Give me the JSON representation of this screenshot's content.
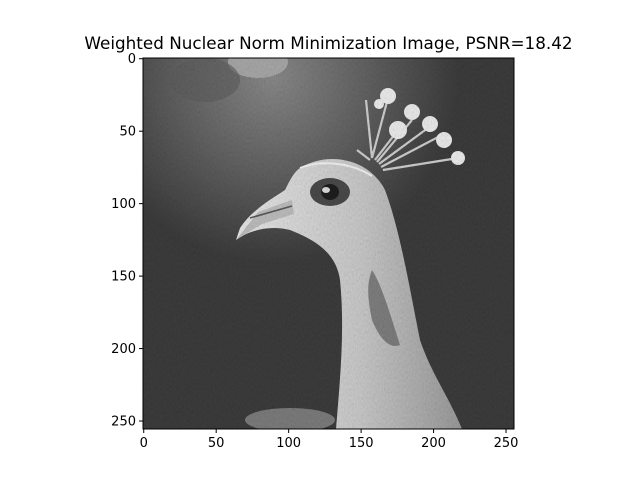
{
  "chart_data": {
    "type": "image",
    "title": "Weighted Nuclear Norm Minimization Image, PSNR=18.42",
    "xlabel": "",
    "ylabel": "",
    "image_width": 256,
    "image_height": 256,
    "xlim": [
      -0.5,
      255.5
    ],
    "ylim": [
      255.5,
      -0.5
    ],
    "colormap": "gray",
    "x_ticks": [
      0,
      50,
      100,
      150,
      200,
      250
    ],
    "x_tick_labels": [
      "0",
      "50",
      "100",
      "150",
      "200",
      "250"
    ],
    "y_ticks": [
      0,
      50,
      100,
      150,
      200,
      250
    ],
    "y_tick_labels": [
      "0",
      "50",
      "100",
      "150",
      "200",
      "250"
    ],
    "image_content": "grayscale photo of a peacock head and crest (denoised)",
    "grid": false,
    "legend": false
  },
  "colors": {
    "background": "#ffffff",
    "axes_frame": "#000000",
    "image_dark": "#3a3a3a",
    "image_light": "#e6e6e6"
  }
}
